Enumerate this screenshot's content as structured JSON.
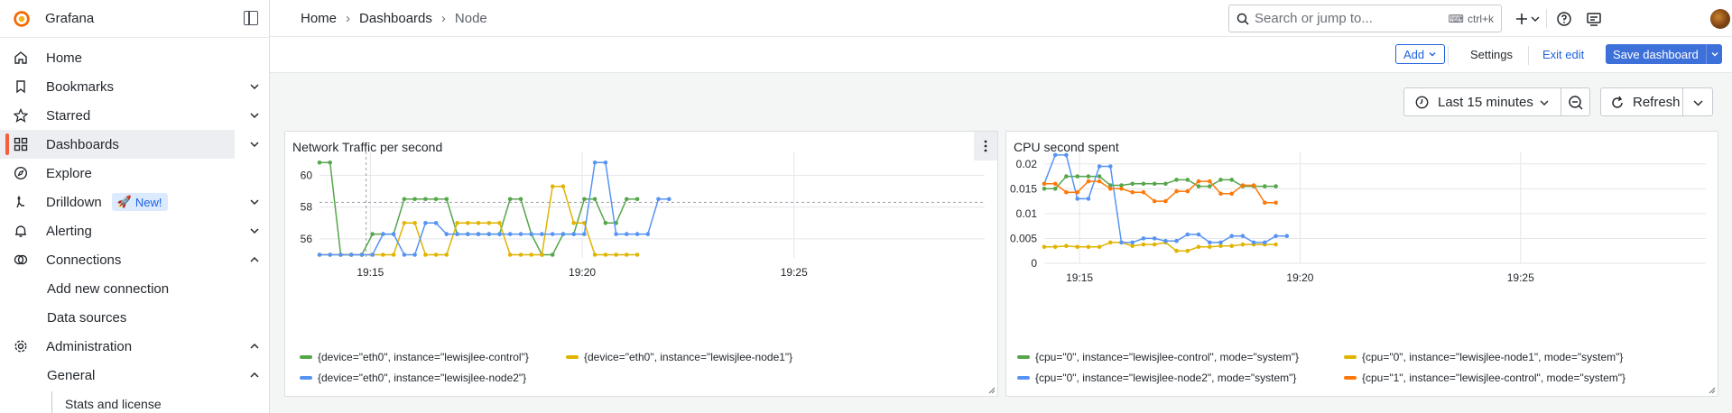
{
  "app": {
    "name": "Grafana"
  },
  "sidebar": {
    "items": [
      {
        "label": "Home",
        "icon": "home-icon"
      },
      {
        "label": "Bookmarks",
        "icon": "bookmark-icon"
      },
      {
        "label": "Starred",
        "icon": "star-icon"
      },
      {
        "label": "Dashboards",
        "icon": "dashboards-icon"
      },
      {
        "label": "Explore",
        "icon": "compass-icon"
      },
      {
        "label": "Drilldown",
        "icon": "drilldown-icon",
        "badge": "New!"
      },
      {
        "label": "Alerting",
        "icon": "bell-icon"
      },
      {
        "label": "Connections",
        "icon": "connections-icon"
      },
      {
        "label": "Add new connection"
      },
      {
        "label": "Data sources"
      },
      {
        "label": "Administration",
        "icon": "gear-icon"
      },
      {
        "label": "General"
      },
      {
        "label": "Stats and license"
      }
    ]
  },
  "breadcrumb": {
    "home": "Home",
    "dashboards": "Dashboards",
    "current": "Node"
  },
  "search": {
    "placeholder": "Search or jump to...",
    "shortcut": "ctrl+k"
  },
  "toolbar": {
    "add_label": "Add",
    "settings_label": "Settings",
    "exit_edit_label": "Exit edit",
    "save_label": "Save dashboard"
  },
  "time": {
    "range_label": "Last 15 minutes",
    "refresh_label": "Refresh"
  },
  "colors": {
    "green": "#56a64b",
    "yellow": "#e0b400",
    "blue": "#5794f2",
    "orange": "#ff780a",
    "accent": "#f55f3e"
  },
  "chart_data": [
    {
      "type": "line",
      "title": "Network Traffic per second",
      "x_ticks": [
        "19:15",
        "19:20",
        "19:25"
      ],
      "y_ticks": [
        "56",
        "58",
        "60"
      ],
      "ylim": [
        54.8,
        61.5
      ],
      "x_start_min": 13.8,
      "x_end_min": 29.5,
      "threshold": 58.3,
      "cursor_min": 14.9,
      "series": [
        {
          "name": "{device=\"eth0\", instance=\"lewisjlee-control\"}",
          "color": "#56a64b",
          "points": [
            [
              13.8,
              60.8
            ],
            [
              14.05,
              60.8
            ],
            [
              14.3,
              55.0
            ],
            [
              14.55,
              55.0
            ],
            [
              14.8,
              55.0
            ],
            [
              15.05,
              56.3
            ],
            [
              15.3,
              56.3
            ],
            [
              15.55,
              56.3
            ],
            [
              15.8,
              58.5
            ],
            [
              16.05,
              58.5
            ],
            [
              16.3,
              58.5
            ],
            [
              16.55,
              58.5
            ],
            [
              16.8,
              58.5
            ],
            [
              17.05,
              56.3
            ],
            [
              17.3,
              56.3
            ],
            [
              17.55,
              56.3
            ],
            [
              17.8,
              56.3
            ],
            [
              18.05,
              56.3
            ],
            [
              18.3,
              58.5
            ],
            [
              18.55,
              58.5
            ],
            [
              18.8,
              56.3
            ],
            [
              19.05,
              55.0
            ],
            [
              19.3,
              55.0
            ],
            [
              19.55,
              56.3
            ],
            [
              19.8,
              56.3
            ],
            [
              20.05,
              58.5
            ],
            [
              20.3,
              58.5
            ],
            [
              20.55,
              57.0
            ],
            [
              20.8,
              57.0
            ],
            [
              21.05,
              58.5
            ],
            [
              21.3,
              58.5
            ]
          ]
        },
        {
          "name": "{device=\"eth0\", instance=\"lewisjlee-node1\"}",
          "color": "#e0b400",
          "points": [
            [
              13.8,
              55.0
            ],
            [
              14.05,
              55.0
            ],
            [
              14.3,
              55.0
            ],
            [
              14.55,
              55.0
            ],
            [
              14.8,
              55.0
            ],
            [
              15.05,
              55.0
            ],
            [
              15.3,
              55.0
            ],
            [
              15.55,
              55.0
            ],
            [
              15.8,
              57.0
            ],
            [
              16.05,
              57.0
            ],
            [
              16.3,
              55.0
            ],
            [
              16.55,
              55.0
            ],
            [
              16.8,
              55.0
            ],
            [
              17.05,
              57.0
            ],
            [
              17.3,
              57.0
            ],
            [
              17.55,
              57.0
            ],
            [
              17.8,
              57.0
            ],
            [
              18.05,
              57.0
            ],
            [
              18.3,
              55.0
            ],
            [
              18.55,
              55.0
            ],
            [
              18.8,
              55.0
            ],
            [
              19.05,
              55.0
            ],
            [
              19.3,
              59.3
            ],
            [
              19.55,
              59.3
            ],
            [
              19.8,
              57.0
            ],
            [
              20.05,
              57.0
            ],
            [
              20.3,
              55.0
            ],
            [
              20.55,
              55.0
            ],
            [
              20.8,
              55.0
            ],
            [
              21.05,
              55.0
            ],
            [
              21.3,
              55.0
            ]
          ]
        },
        {
          "name": "{device=\"eth0\", instance=\"lewisjlee-node2\"}",
          "color": "#5794f2",
          "points": [
            [
              13.8,
              55.0
            ],
            [
              14.05,
              55.0
            ],
            [
              14.3,
              55.0
            ],
            [
              14.55,
              55.0
            ],
            [
              14.8,
              55.0
            ],
            [
              15.05,
              55.0
            ],
            [
              15.3,
              56.3
            ],
            [
              15.55,
              56.3
            ],
            [
              15.8,
              55.0
            ],
            [
              16.05,
              55.0
            ],
            [
              16.3,
              57.0
            ],
            [
              16.55,
              57.0
            ],
            [
              16.8,
              56.3
            ],
            [
              17.05,
              56.3
            ],
            [
              17.3,
              56.3
            ],
            [
              17.55,
              56.3
            ],
            [
              17.8,
              56.3
            ],
            [
              18.05,
              56.3
            ],
            [
              18.3,
              56.3
            ],
            [
              18.55,
              56.3
            ],
            [
              18.8,
              56.3
            ],
            [
              19.05,
              56.3
            ],
            [
              19.3,
              56.3
            ],
            [
              19.55,
              56.3
            ],
            [
              19.8,
              56.3
            ],
            [
              20.05,
              56.3
            ],
            [
              20.3,
              60.8
            ],
            [
              20.55,
              60.8
            ],
            [
              20.8,
              56.3
            ],
            [
              21.05,
              56.3
            ],
            [
              21.3,
              56.3
            ],
            [
              21.55,
              56.3
            ],
            [
              21.8,
              58.5
            ],
            [
              22.05,
              58.5
            ]
          ]
        }
      ]
    },
    {
      "type": "line",
      "title": "CPU second spent",
      "x_ticks": [
        "19:15",
        "19:20",
        "19:25"
      ],
      "y_ticks": [
        "0",
        "0.005",
        "0.01",
        "0.015",
        "0.02"
      ],
      "ylim": [
        0,
        0.0225
      ],
      "x_start_min": 14.2,
      "x_end_min": 29.2,
      "series": [
        {
          "name": "{cpu=\"0\", instance=\"lewisjlee-control\", mode=\"system\"}",
          "color": "#56a64b",
          "points": [
            [
              14.2,
              0.015
            ],
            [
              14.45,
              0.015
            ],
            [
              14.7,
              0.0175
            ],
            [
              14.95,
              0.0175
            ],
            [
              15.2,
              0.0175
            ],
            [
              15.45,
              0.0175
            ],
            [
              15.7,
              0.0157
            ],
            [
              15.95,
              0.0157
            ],
            [
              16.2,
              0.016
            ],
            [
              16.45,
              0.016
            ],
            [
              16.7,
              0.016
            ],
            [
              16.95,
              0.016
            ],
            [
              17.2,
              0.0168
            ],
            [
              17.45,
              0.0168
            ],
            [
              17.7,
              0.0155
            ],
            [
              17.95,
              0.0155
            ],
            [
              18.2,
              0.0168
            ],
            [
              18.45,
              0.0168
            ],
            [
              18.7,
              0.0155
            ],
            [
              18.95,
              0.0155
            ],
            [
              19.2,
              0.0155
            ],
            [
              19.45,
              0.0155
            ]
          ]
        },
        {
          "name": "{cpu=\"0\", instance=\"lewisjlee-node1\", mode=\"system\"}",
          "color": "#e0b400",
          "points": [
            [
              14.2,
              0.0033
            ],
            [
              14.45,
              0.0033
            ],
            [
              14.7,
              0.0035
            ],
            [
              14.95,
              0.0033
            ],
            [
              15.2,
              0.0033
            ],
            [
              15.45,
              0.0033
            ],
            [
              15.7,
              0.0042
            ],
            [
              15.95,
              0.0042
            ],
            [
              16.2,
              0.0035
            ],
            [
              16.45,
              0.0038
            ],
            [
              16.7,
              0.0038
            ],
            [
              16.95,
              0.0042
            ],
            [
              17.2,
              0.0025
            ],
            [
              17.45,
              0.0025
            ],
            [
              17.7,
              0.0033
            ],
            [
              17.95,
              0.0033
            ],
            [
              18.2,
              0.0035
            ],
            [
              18.45,
              0.0035
            ],
            [
              18.7,
              0.0038
            ],
            [
              18.95,
              0.0038
            ],
            [
              19.2,
              0.0038
            ],
            [
              19.45,
              0.0038
            ]
          ]
        },
        {
          "name": "{cpu=\"0\", instance=\"lewisjlee-node2\", mode=\"system\"}",
          "color": "#5794f2",
          "points": [
            [
              14.2,
              0.016
            ],
            [
              14.45,
              0.0218
            ],
            [
              14.7,
              0.0218
            ],
            [
              14.95,
              0.013
            ],
            [
              15.2,
              0.013
            ],
            [
              15.45,
              0.0195
            ],
            [
              15.7,
              0.0195
            ],
            [
              15.95,
              0.0042
            ],
            [
              16.2,
              0.0042
            ],
            [
              16.45,
              0.005
            ],
            [
              16.7,
              0.005
            ],
            [
              16.95,
              0.0045
            ],
            [
              17.2,
              0.0045
            ],
            [
              17.45,
              0.0058
            ],
            [
              17.7,
              0.0058
            ],
            [
              17.95,
              0.0042
            ],
            [
              18.2,
              0.0042
            ],
            [
              18.45,
              0.0055
            ],
            [
              18.7,
              0.0055
            ],
            [
              18.95,
              0.0042
            ],
            [
              19.2,
              0.0042
            ],
            [
              19.45,
              0.0055
            ],
            [
              19.7,
              0.0055
            ]
          ]
        },
        {
          "name": "{cpu=\"1\", instance=\"lewisjlee-control\", mode=\"system\"}",
          "color": "#ff780a",
          "points": [
            [
              14.2,
              0.016
            ],
            [
              14.45,
              0.016
            ],
            [
              14.7,
              0.0143
            ],
            [
              14.95,
              0.0143
            ],
            [
              15.2,
              0.0165
            ],
            [
              15.45,
              0.0165
            ],
            [
              15.7,
              0.015
            ],
            [
              15.95,
              0.015
            ],
            [
              16.2,
              0.0143
            ],
            [
              16.45,
              0.0143
            ],
            [
              16.7,
              0.0125
            ],
            [
              16.95,
              0.0125
            ],
            [
              17.2,
              0.0145
            ],
            [
              17.45,
              0.0145
            ],
            [
              17.7,
              0.0165
            ],
            [
              17.95,
              0.0165
            ],
            [
              18.2,
              0.014
            ],
            [
              18.45,
              0.014
            ],
            [
              18.7,
              0.0157
            ],
            [
              18.95,
              0.0157
            ],
            [
              19.2,
              0.0122
            ],
            [
              19.45,
              0.0122
            ]
          ]
        }
      ]
    }
  ]
}
